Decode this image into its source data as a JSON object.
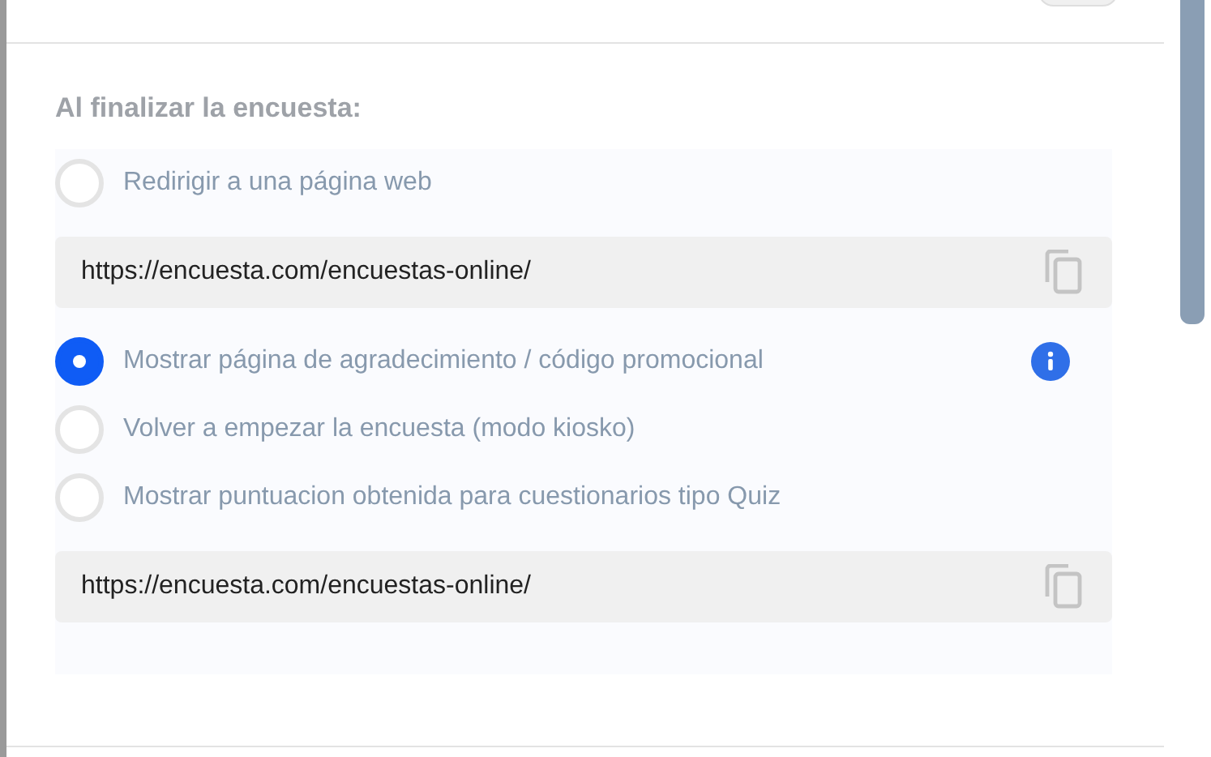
{
  "heading": "Al finalizar la encuesta:",
  "options": [
    {
      "kind": "radio",
      "label": "Redirigir a una página web",
      "selected": false,
      "info": false
    },
    {
      "kind": "url",
      "value": "https://encuesta.com/encuestas-online/"
    },
    {
      "kind": "radio",
      "label": "Mostrar página de agradecimiento / código promocional",
      "selected": true,
      "info": true
    },
    {
      "kind": "radio",
      "label": "Volver a empezar la encuesta (modo kiosko)",
      "selected": false,
      "info": false
    },
    {
      "kind": "radio",
      "label": "Mostrar puntuacion obtenida para cuestionarios tipo Quiz",
      "selected": false,
      "info": false
    },
    {
      "kind": "url",
      "value": "https://encuesta.com/encuestas-online/"
    }
  ]
}
